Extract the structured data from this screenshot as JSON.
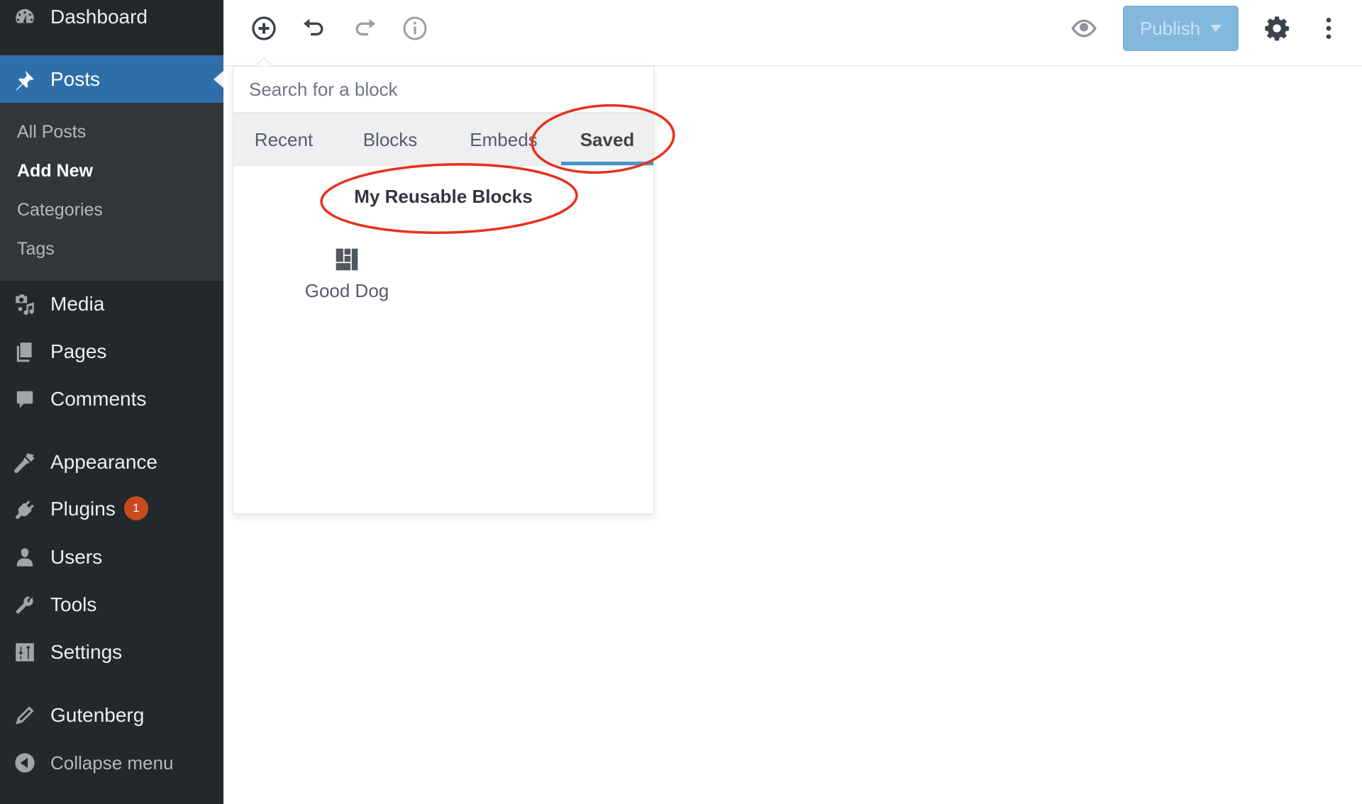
{
  "sidebar": {
    "items": [
      {
        "id": "dashboard",
        "label": "Dashboard",
        "icon": "dashboard-icon"
      },
      {
        "id": "posts",
        "label": "Posts",
        "icon": "pin-icon",
        "active": true
      },
      {
        "id": "media",
        "label": "Media",
        "icon": "media-icon"
      },
      {
        "id": "pages",
        "label": "Pages",
        "icon": "pages-icon"
      },
      {
        "id": "comments",
        "label": "Comments",
        "icon": "comment-icon"
      },
      {
        "id": "appearance",
        "label": "Appearance",
        "icon": "paintbrush-icon"
      },
      {
        "id": "plugins",
        "label": "Plugins",
        "icon": "plugin-icon",
        "badge": "1"
      },
      {
        "id": "users",
        "label": "Users",
        "icon": "user-icon"
      },
      {
        "id": "tools",
        "label": "Tools",
        "icon": "wrench-icon"
      },
      {
        "id": "settings",
        "label": "Settings",
        "icon": "sliders-icon"
      },
      {
        "id": "gutenberg",
        "label": "Gutenberg",
        "icon": "pencil-icon"
      }
    ],
    "submenu": [
      {
        "label": "All Posts"
      },
      {
        "label": "Add New",
        "current": true
      },
      {
        "label": "Categories"
      },
      {
        "label": "Tags"
      }
    ],
    "collapse_label": "Collapse menu"
  },
  "header": {
    "tools": [
      "add-block",
      "undo",
      "redo",
      "content-info"
    ],
    "publish_label": "Publish",
    "icons": {
      "preview": "eye-icon",
      "settings": "gear-icon",
      "more": "more-vertical-icon"
    }
  },
  "inserter": {
    "search_placeholder": "Search for a block",
    "tabs": [
      {
        "label": "Recent"
      },
      {
        "label": "Blocks"
      },
      {
        "label": "Embeds"
      },
      {
        "label": "Saved",
        "active": true
      }
    ],
    "panel_title": "My Reusable Blocks",
    "blocks": [
      {
        "name": "Good Dog",
        "icon": "reusable-block-icon"
      }
    ]
  },
  "annotations": {
    "color": "#e8301c",
    "highlights": [
      "tab-saved",
      "panel-title"
    ]
  },
  "colors": {
    "sidebar_bg": "#23282d",
    "submenu_bg": "#32373c",
    "active_menu": "#2e6faa",
    "publish_bg": "#84b7dc",
    "tab_underline": "#4a96c8",
    "badge": "#ca4a1f"
  }
}
